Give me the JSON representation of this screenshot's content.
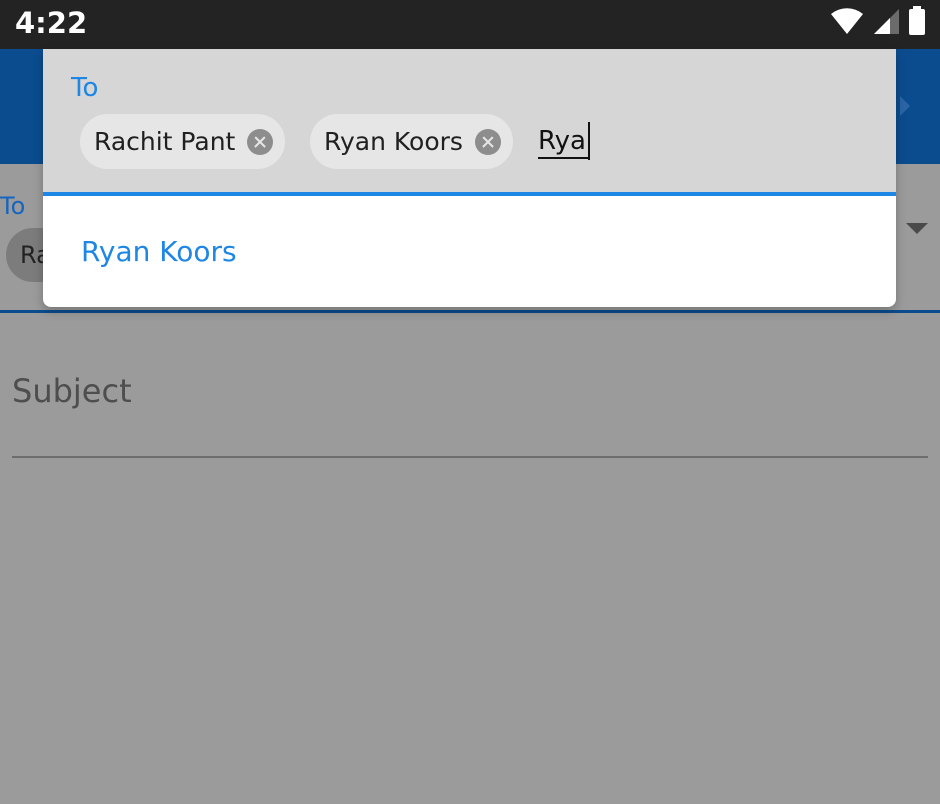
{
  "status_bar": {
    "time": "4:22",
    "icons": [
      "wifi-icon",
      "cellular-signal-icon",
      "battery-icon"
    ]
  },
  "app_bar": {
    "color": "#0b4c8f",
    "action_icon": "send-icon"
  },
  "compose_form": {
    "to_label": "To",
    "visible_chip_fragment": "Ra",
    "dropdown_icon": "dropdown-arrow-icon",
    "subject_placeholder": "Subject"
  },
  "recipient_overlay": {
    "to_label": "To",
    "chips": [
      {
        "label": "Rachit Pant",
        "remove_icon": "close-circle-icon"
      },
      {
        "label": "Ryan Koors",
        "remove_icon": "close-circle-icon"
      }
    ],
    "input_value": "Rya",
    "suggestions": [
      "Ryan Koors"
    ]
  },
  "colors": {
    "accent": "#1e86e4",
    "status_bar": "#232323",
    "scrim": "#9b9b9b",
    "chip": "#e6e6e6"
  }
}
